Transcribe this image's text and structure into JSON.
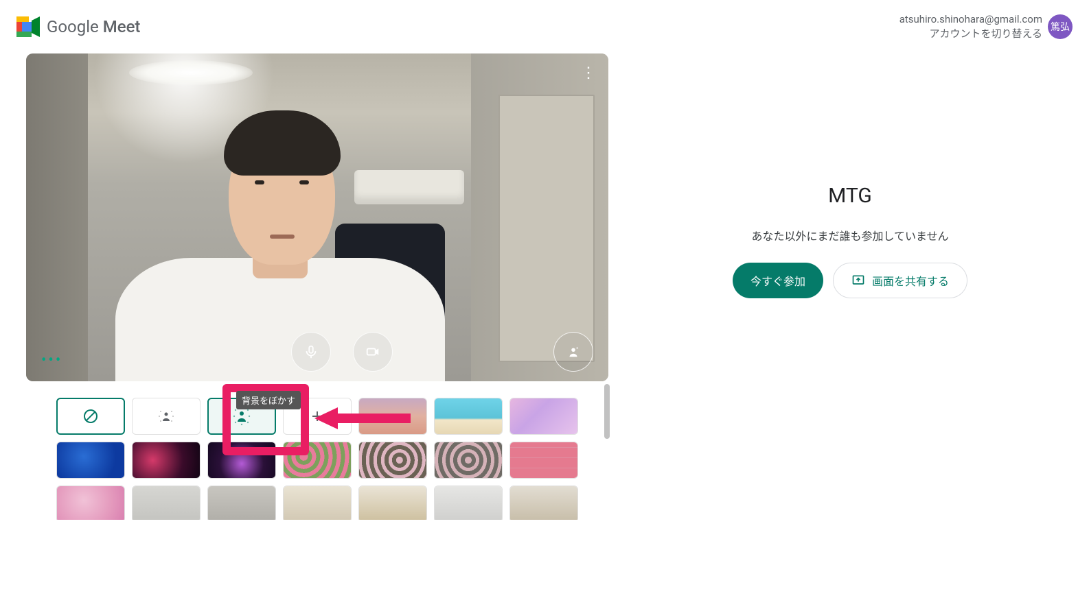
{
  "brand": {
    "name_prefix": "Google ",
    "name_bold": "Meet"
  },
  "account": {
    "email": "atsuhiro.shinohara@gmail.com",
    "switch_label": "アカウントを切り替える",
    "avatar_initials": "篤弘"
  },
  "preview": {
    "tooltip_blur": "背景をぼかす"
  },
  "backgrounds": {
    "options": [
      {
        "id": "none",
        "kind": "none"
      },
      {
        "id": "blur-light",
        "kind": "blur-light"
      },
      {
        "id": "blur",
        "kind": "blur"
      },
      {
        "id": "upload",
        "kind": "upload"
      },
      {
        "id": "sunset",
        "kind": "gradient",
        "css": "linear-gradient(180deg,#c7a9c2 0%,#e1b0a0 50%,#d99a86 100%)"
      },
      {
        "id": "beach",
        "kind": "gradient",
        "css": "linear-gradient(180deg,#6fd3e8 0%,#5cc3d8 55%,#f2e6c8 60%,#e6d7b4 100%)"
      },
      {
        "id": "clouds-pink",
        "kind": "gradient",
        "css": "linear-gradient(135deg,#e6b6e0 0%,#c9a4e6 40%,#e7c3ec 100%)"
      },
      {
        "id": "ocean",
        "kind": "gradient",
        "css": "radial-gradient(circle at 40% 40%, #2a6dd4 0%, #0d3aa0 70%)"
      },
      {
        "id": "nebula",
        "kind": "gradient",
        "css": "radial-gradient(circle at 30% 50%, #d53a6a 0%, #3a0b2a 60%, #120414 100%)"
      },
      {
        "id": "fireworks",
        "kind": "gradient",
        "css": "radial-gradient(circle at 50% 60%, #b45bd6 0%, #2a1038 55%, #140820 100%)"
      },
      {
        "id": "flowers1",
        "kind": "gradient",
        "css": "repeating-radial-gradient(circle at 30% 40%, #e97c9c 0 6px, #7da05c 6px 12px)"
      },
      {
        "id": "flowers2",
        "kind": "gradient",
        "css": "repeating-radial-gradient(circle at 60% 50%, #dfb6c2 0 5px, #6a6154 5px 11px)"
      },
      {
        "id": "flowers3",
        "kind": "gradient",
        "css": "repeating-radial-gradient(circle at 50% 50%, #d5b2b8 0 5px, #6f6b65 5px 11px)"
      },
      {
        "id": "pattern-pink",
        "kind": "gradient",
        "css": "repeating-linear-gradient(0deg,#e57a8f 0 14px,#e08da0 14px 15px), repeating-linear-gradient(90deg,rgba(0,0,0,0) 0 14px, rgba(255,255,255,0.5) 14px 15px)"
      },
      {
        "id": "sakura",
        "kind": "gradient",
        "css": "radial-gradient(circle at 40% 40%, #f1c2d7 0%, #e49abd 60%, #d97fb0 100%)"
      },
      {
        "id": "office1",
        "kind": "gradient",
        "css": "linear-gradient(180deg,#d6d6d2 0%,#c4c4c0 100%)"
      },
      {
        "id": "office2",
        "kind": "gradient",
        "css": "linear-gradient(180deg,#c8c6c0 0%,#b0aea8 100%)"
      },
      {
        "id": "room1",
        "kind": "gradient",
        "css": "linear-gradient(180deg,#e9e3d3 0%,#d2c8b3 100%)"
      },
      {
        "id": "room2",
        "kind": "gradient",
        "css": "linear-gradient(180deg,#eae4d6 0%,#cdbf9e 100%)"
      },
      {
        "id": "room3",
        "kind": "gradient",
        "css": "linear-gradient(180deg,#e6e6e4 0%,#cfcfcd 100%)"
      },
      {
        "id": "room4",
        "kind": "gradient",
        "css": "linear-gradient(180deg,#e2ddd2 0%,#c7bda8 100%)"
      }
    ]
  },
  "meeting": {
    "title": "MTG",
    "status": "あなた以外にまだ誰も参加していません",
    "join_label": "今すぐ参加",
    "present_label": "画面を共有する"
  },
  "colors": {
    "accent": "#057b69",
    "highlight": "#e91e63"
  }
}
